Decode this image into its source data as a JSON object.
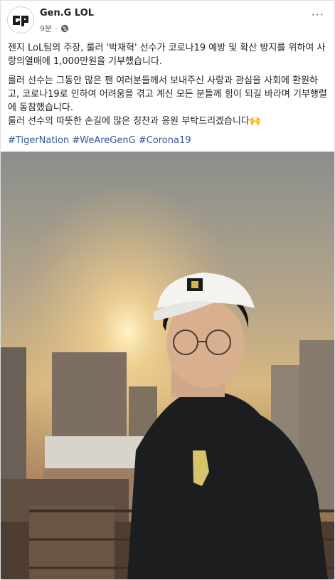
{
  "post": {
    "page_name": "Gen.G LOL",
    "timestamp": "9분",
    "privacy_icon": "globe-icon",
    "more_label": "···",
    "paragraph1": "젠지 LoL팀의 주장, 룰러 '박재혁' 선수가 코로나19 예방 및 확산 방지를 위하여 사랑의열매에 1,000만원을 기부했습니다.",
    "paragraph2_line1": "룰러 선수는 그동안 많은 팬 여러분들께서 보내주신 사랑과 관심을 사회에 환원하고, 코로나19로 인하여 어려움을 겪고 계신 모든 분들께 힘이 되길 바라며 기부행렬에 동참했습니다.",
    "paragraph2_line2": "룰러 선수의 따뜻한 손길에 많은 칭찬과 응원 부탁드리겠습니다🙌",
    "hashtags": "#TigerNation #WeAreGenG #Corona19"
  },
  "colors": {
    "link": "#385898",
    "text": "#1d2129",
    "meta": "#616770"
  }
}
